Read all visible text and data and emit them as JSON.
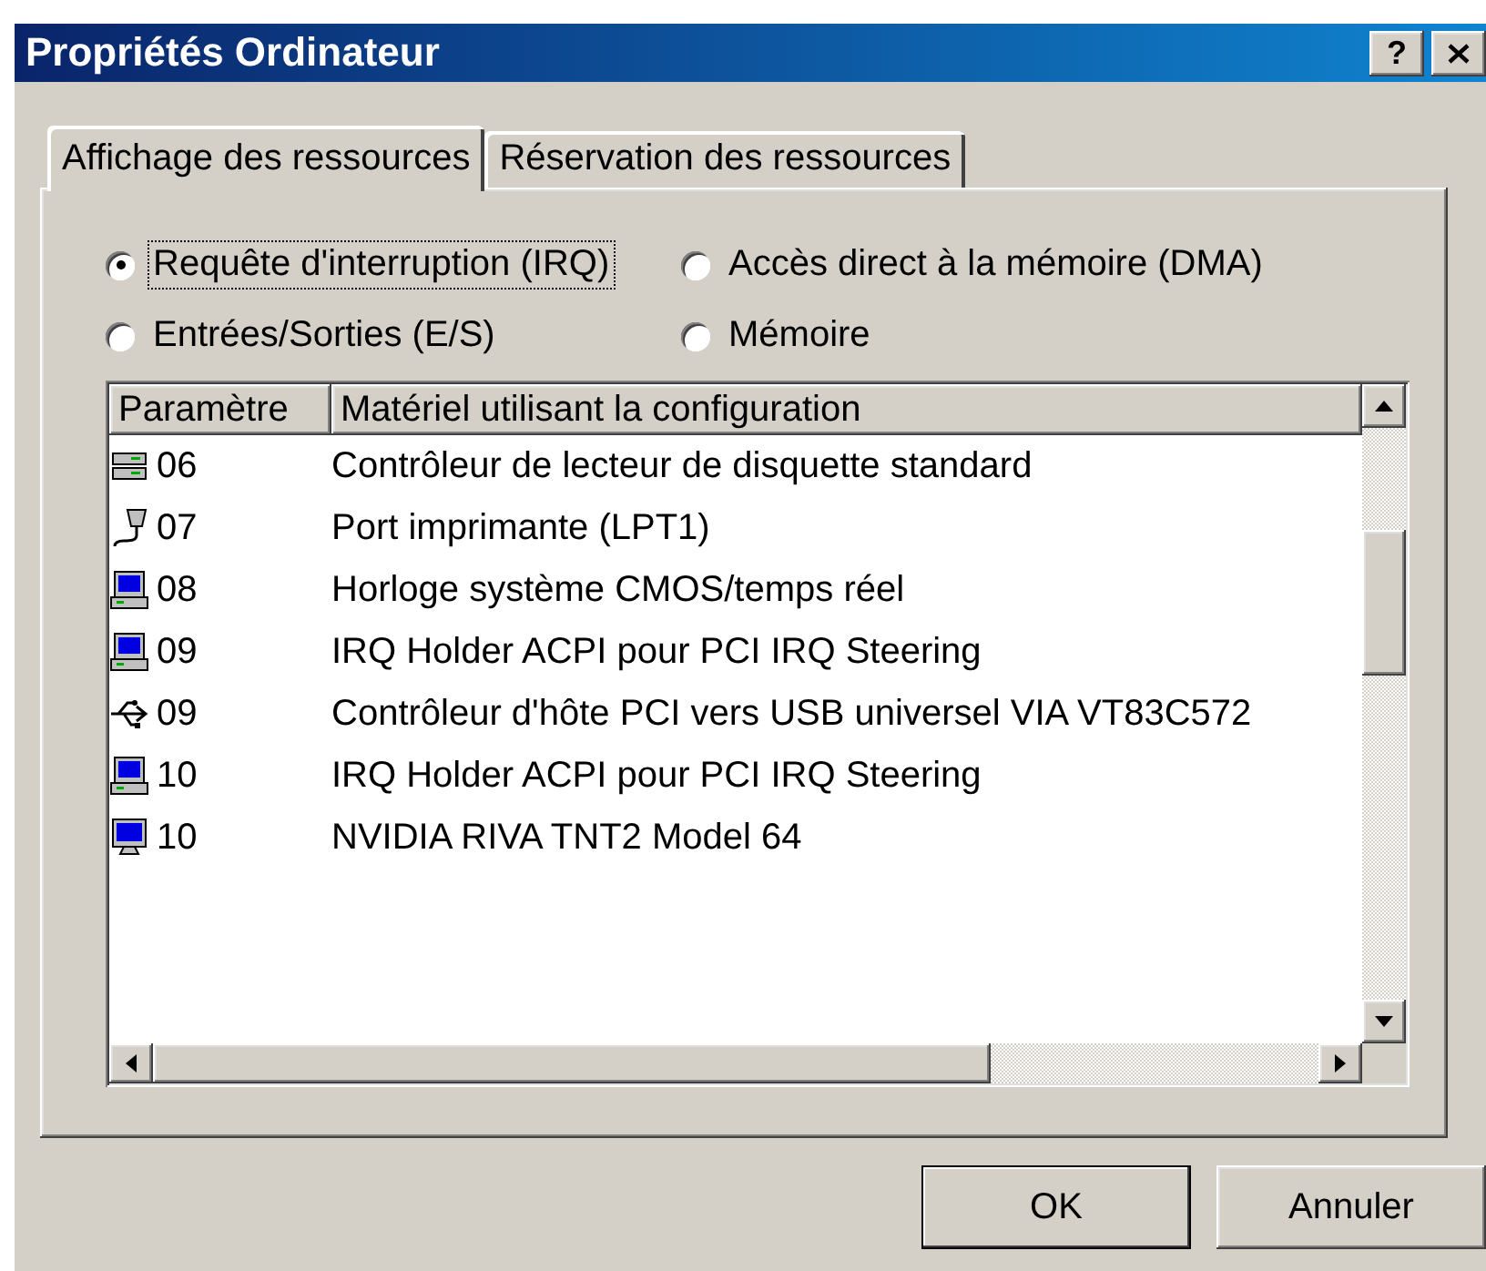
{
  "window": {
    "title": "Propriétés Ordinateur",
    "help": "?"
  },
  "tabs": [
    {
      "label": "Affichage des ressources",
      "selected": true
    },
    {
      "label": "Réservation des ressources",
      "selected": false
    }
  ],
  "radios": [
    {
      "label": "Requête d'interruption (IRQ)",
      "selected": true
    },
    {
      "label": "Accès direct à la mémoire (DMA)",
      "selected": false
    },
    {
      "label": "Entrées/Sorties (E/S)",
      "selected": false
    },
    {
      "label": "Mémoire",
      "selected": false
    }
  ],
  "table": {
    "columns": [
      "Paramètre",
      "Matériel utilisant la configuration"
    ],
    "rows": [
      {
        "kind": "floppy",
        "setting": "06",
        "device": "Contrôleur de lecteur de disquette standard"
      },
      {
        "kind": "port",
        "setting": "07",
        "device": "Port imprimante (LPT1)"
      },
      {
        "kind": "computer",
        "setting": "08",
        "device": "Horloge système CMOS/temps réel"
      },
      {
        "kind": "computer",
        "setting": "09",
        "device": "IRQ Holder ACPI pour PCI IRQ Steering"
      },
      {
        "kind": "usb",
        "setting": "09",
        "device": "Contrôleur d'hôte PCI vers USB universel VIA VT83C572"
      },
      {
        "kind": "computer",
        "setting": "10",
        "device": "IRQ Holder ACPI pour PCI IRQ Steering"
      },
      {
        "kind": "monitor",
        "setting": "10",
        "device": "NVIDIA RIVA TNT2 Model 64"
      }
    ]
  },
  "buttons": [
    {
      "label": "OK",
      "default": true
    },
    {
      "label": "Annuler",
      "default": false
    }
  ]
}
